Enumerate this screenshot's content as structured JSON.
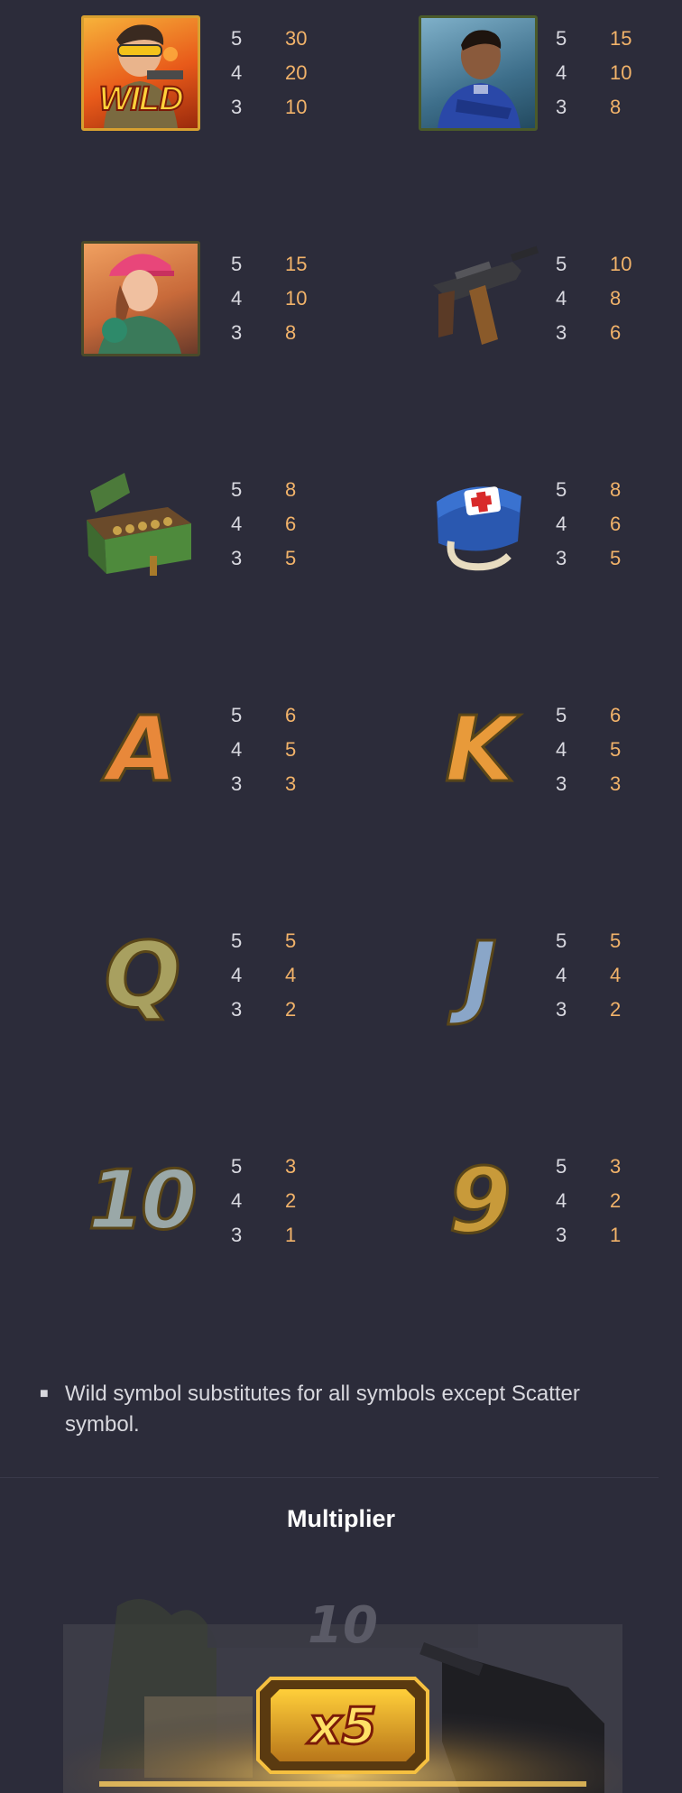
{
  "colors": {
    "background": "#2c2c3a",
    "count": "#d9d9e0",
    "payout": "#f2b36a"
  },
  "symbols": [
    {
      "name": "wild",
      "label": "WILD",
      "pays": [
        {
          "count": "5",
          "value": "30"
        },
        {
          "count": "4",
          "value": "20"
        },
        {
          "count": "3",
          "value": "10"
        }
      ]
    },
    {
      "name": "hero-male",
      "pays": [
        {
          "count": "5",
          "value": "15"
        },
        {
          "count": "4",
          "value": "10"
        },
        {
          "count": "3",
          "value": "8"
        }
      ]
    },
    {
      "name": "hero-female",
      "pays": [
        {
          "count": "5",
          "value": "15"
        },
        {
          "count": "4",
          "value": "10"
        },
        {
          "count": "3",
          "value": "8"
        }
      ]
    },
    {
      "name": "submachine-gun",
      "pays": [
        {
          "count": "5",
          "value": "10"
        },
        {
          "count": "4",
          "value": "8"
        },
        {
          "count": "3",
          "value": "6"
        }
      ]
    },
    {
      "name": "ammo-crate",
      "pays": [
        {
          "count": "5",
          "value": "8"
        },
        {
          "count": "4",
          "value": "6"
        },
        {
          "count": "3",
          "value": "5"
        }
      ]
    },
    {
      "name": "medkit",
      "pays": [
        {
          "count": "5",
          "value": "8"
        },
        {
          "count": "4",
          "value": "6"
        },
        {
          "count": "3",
          "value": "5"
        }
      ]
    },
    {
      "name": "letter-a",
      "label": "A",
      "pays": [
        {
          "count": "5",
          "value": "6"
        },
        {
          "count": "4",
          "value": "5"
        },
        {
          "count": "3",
          "value": "3"
        }
      ]
    },
    {
      "name": "letter-k",
      "label": "K",
      "pays": [
        {
          "count": "5",
          "value": "6"
        },
        {
          "count": "4",
          "value": "5"
        },
        {
          "count": "3",
          "value": "3"
        }
      ]
    },
    {
      "name": "letter-q",
      "label": "Q",
      "pays": [
        {
          "count": "5",
          "value": "5"
        },
        {
          "count": "4",
          "value": "4"
        },
        {
          "count": "3",
          "value": "2"
        }
      ]
    },
    {
      "name": "letter-j",
      "label": "J",
      "pays": [
        {
          "count": "5",
          "value": "5"
        },
        {
          "count": "4",
          "value": "4"
        },
        {
          "count": "3",
          "value": "2"
        }
      ]
    },
    {
      "name": "number-10",
      "label": "10",
      "pays": [
        {
          "count": "5",
          "value": "3"
        },
        {
          "count": "4",
          "value": "2"
        },
        {
          "count": "3",
          "value": "1"
        }
      ]
    },
    {
      "name": "number-9",
      "label": "9",
      "pays": [
        {
          "count": "5",
          "value": "3"
        },
        {
          "count": "4",
          "value": "2"
        },
        {
          "count": "3",
          "value": "1"
        }
      ]
    }
  ],
  "rules": [
    "Wild symbol substitutes for all symbols except Scatter symbol."
  ],
  "multiplier": {
    "title": "Multiplier",
    "value_label": "x5",
    "background_label": "10"
  }
}
